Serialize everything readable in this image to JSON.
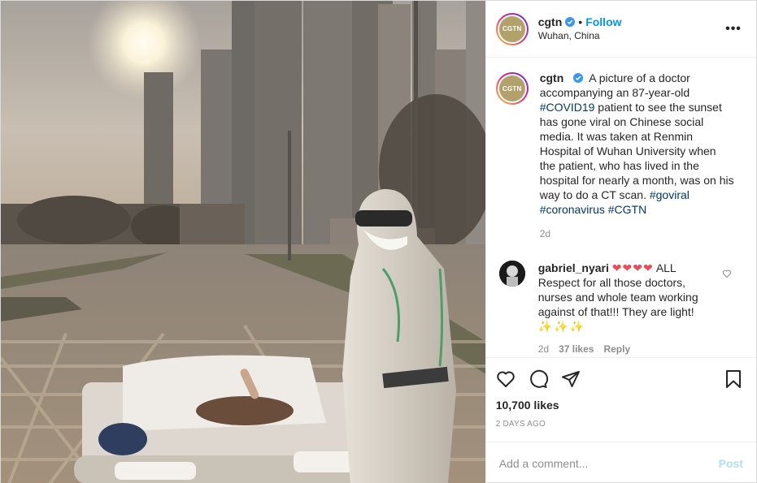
{
  "header": {
    "username": "cgtn",
    "follow_label": "Follow",
    "location": "Wuhan, China",
    "avatar_text": "CGTN",
    "more_label": "•••"
  },
  "caption": {
    "username": "cgtn",
    "text_before": "A picture of a doctor accompanying an 87-year-old ",
    "tag1": "#COVID19",
    "text_after": " patient to see the sunset has gone viral on Chinese social media. It was taken at Renmin Hospital of Wuhan University when the patient, who has lived in the hospital for nearly a month, was on his way to do a CT scan. ",
    "tag2": "#goviral",
    "tag3": "#coronavirus",
    "tag4": "#CGTN",
    "time": "2d"
  },
  "comment": {
    "username": "gabriel_nyari",
    "hearts": "❤❤❤❤",
    "text": "ALL Respect for all those doctors, nurses and whole team working against of that!!! They are light!",
    "stars": "✨✨✨",
    "time": "2d",
    "likes": "37 likes",
    "reply_label": "Reply"
  },
  "actions": {
    "likes_count": "10,700 likes",
    "date": "2 DAYS AGO"
  },
  "add_comment": {
    "placeholder": "Add a comment...",
    "post_label": "Post"
  },
  "icons": [
    "verified-icon",
    "heart-icon",
    "comment-icon",
    "share-icon",
    "save-icon",
    "comment-like-icon"
  ],
  "colors": {
    "link_blue": "#0095f6",
    "hashtag": "#00376b",
    "muted": "#8e8e8e",
    "avatar_gold": "#b2a16b"
  }
}
